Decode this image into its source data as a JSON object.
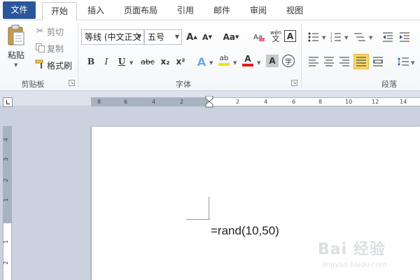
{
  "tabs": [
    {
      "label": "文件"
    },
    {
      "label": "开始"
    },
    {
      "label": "插入"
    },
    {
      "label": "页面布局"
    },
    {
      "label": "引用"
    },
    {
      "label": "邮件"
    },
    {
      "label": "审阅"
    },
    {
      "label": "视图"
    }
  ],
  "active_tab": "开始",
  "clipboard": {
    "paste_label": "粘贴",
    "cut_label": "剪切",
    "copy_label": "复制",
    "format_painter_label": "格式刷",
    "group_label": "剪贴板"
  },
  "font": {
    "font_name": "等线 (中文正文",
    "font_size": "五号",
    "group_label": "字体",
    "change_case_glyph": "Aa",
    "bold_glyph": "B",
    "italic_glyph": "I",
    "underline_glyph": "U",
    "strikethrough_glyph": "abc",
    "subscript_glyph": "x₂",
    "superscript_glyph": "x²",
    "text_effect_glyph": "A",
    "highlight_glyph": "ab",
    "font_color_glyph": "A",
    "char_shading_glyph": "A",
    "enclose_glyph": "字",
    "phonetic_glyph": "wén",
    "grow_glyph": "A",
    "shrink_glyph": "A",
    "clear_glyph": "A"
  },
  "paragraph": {
    "group_label": "段落",
    "active_alignment": "justify"
  },
  "ruler": {
    "h_ticks": [
      "8",
      "6",
      "4",
      "2",
      "2",
      "4",
      "6",
      "8",
      "10",
      "12",
      "14"
    ],
    "v_ticks": [
      "4",
      "3",
      "2",
      "1",
      "1",
      "2"
    ]
  },
  "document": {
    "text": "=rand(10,50)"
  },
  "watermark": {
    "main": "Bai  经验",
    "sub": "jingyan.baidu.com"
  },
  "colors": {
    "file_tab": "#2b579a",
    "font_color_bar": "#e02020",
    "highlight_bar": "#f5e400",
    "pressed": "#f6d66d"
  }
}
